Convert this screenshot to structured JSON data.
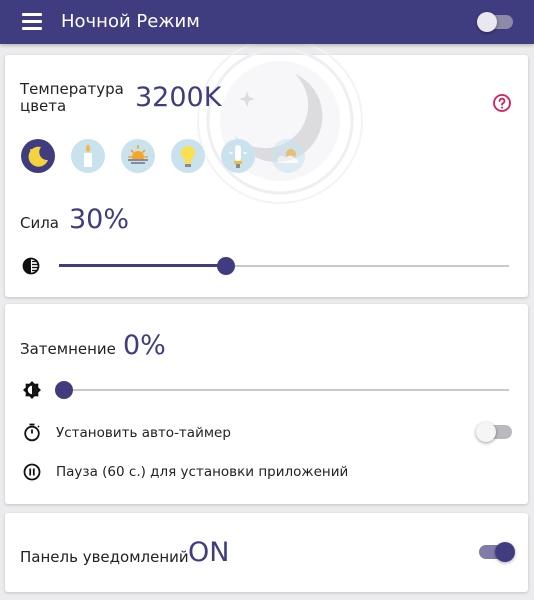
{
  "app_bar": {
    "title": "Ночной Режим",
    "master_toggle_on": false
  },
  "color_temperature": {
    "label": "Температура цвета",
    "value": "3200K",
    "presets": [
      {
        "icon": "moon-icon",
        "selected": true
      },
      {
        "icon": "candle-icon",
        "selected": false
      },
      {
        "icon": "sunset-icon",
        "selected": false
      },
      {
        "icon": "lightbulb-icon",
        "selected": false
      },
      {
        "icon": "fluorescent-lamp-icon",
        "selected": false
      },
      {
        "icon": "daylight-icon",
        "selected": false
      }
    ]
  },
  "intensity": {
    "label": "Сила",
    "value": "30%",
    "slider_fraction": 0.37
  },
  "dim": {
    "label": "Затемнение",
    "value": "0%",
    "slider_fraction": 0.0
  },
  "options": {
    "auto_timer_label": "Установить авто-таймер",
    "auto_timer_on": false,
    "pause_label": "Пауза (60 с.) для установки приложений"
  },
  "notification": {
    "label": "Панель уведомлений",
    "value": "ON",
    "toggle_on": true
  },
  "colors": {
    "primary": "#3f3d7f",
    "help_accent": "#d81b60",
    "preset_bg": "#c9e2ee"
  }
}
